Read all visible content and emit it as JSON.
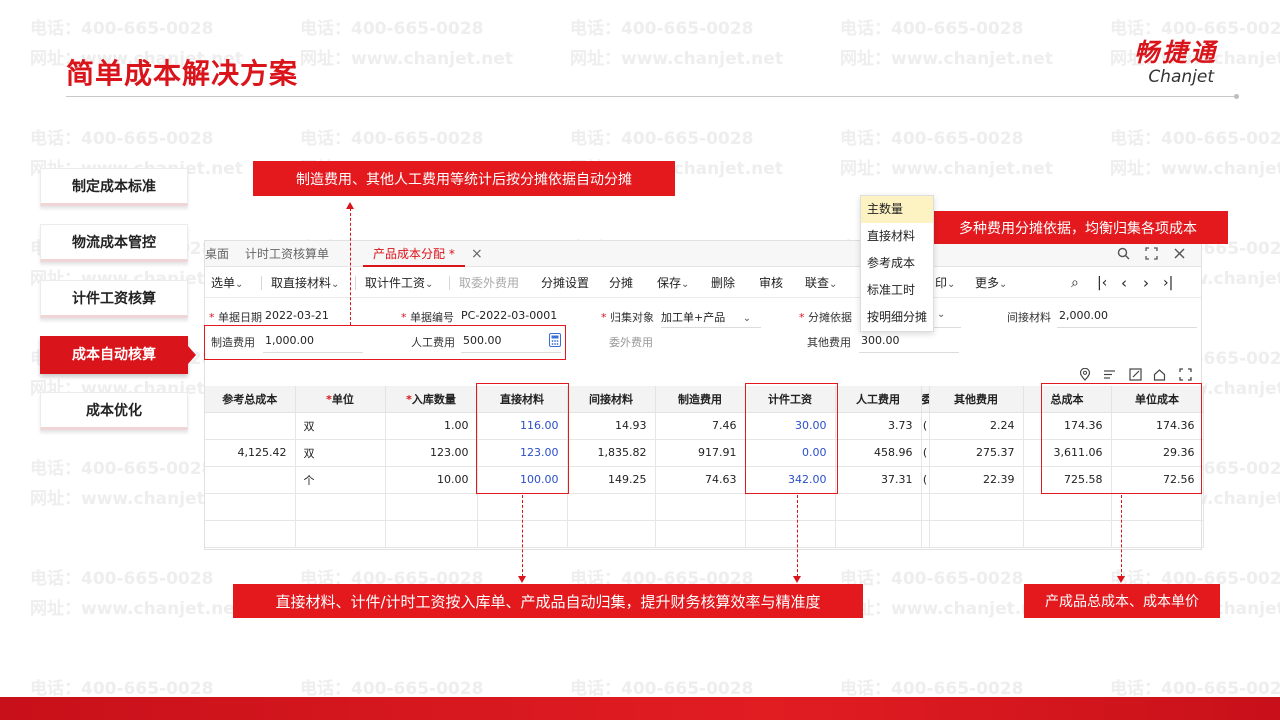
{
  "watermark": {
    "phone": "电话：400-665-0028",
    "site": "网址：www.chanjet.net"
  },
  "page": {
    "title": "简单成本解决方案"
  },
  "logo": {
    "cn": "畅捷通",
    "en": "Chanjet"
  },
  "nav": {
    "items": [
      "制定成本标准",
      "物流成本管控",
      "计件工资核算",
      "成本自动核算",
      "成本优化"
    ],
    "active_index": 3
  },
  "callouts": {
    "top": "制造费用、其他人工费用等统计后按分摊依据自动分摊",
    "right": "多种费用分摊依据，均衡归集各项成本",
    "bottom": "直接材料、计件/计时工资按入库单、产成品自动归集，提升财务核算效率与精准度",
    "bottom_right": "产成品总成本、成本单价"
  },
  "app": {
    "tabs": {
      "partial": "桌面",
      "second": "计时工资核算单",
      "active": "产品成本分配 *",
      "close": "×"
    },
    "toolbar": {
      "select": "选单",
      "take_material": "取直接材料",
      "take_piece": "取计件工资",
      "take_outsource": "取委外费用",
      "alloc_setting": "分摊设置",
      "alloc": "分摊",
      "save": "保存",
      "delete": "删除",
      "audit": "审核",
      "linked": "联查",
      "print_partial": "印",
      "more": "更多"
    },
    "form": {
      "date_label": "单据日期",
      "date_value": "2022-03-21",
      "number_label": "单据编号",
      "number_value": "PC-2022-03-0001",
      "collect_label": "归集对象",
      "collect_value": "加工单+产品",
      "basis_label": "分摊依据",
      "basis_value": "按明细分摊",
      "indirect_label": "间接材料",
      "indirect_value": "2,000.00",
      "mfg_label": "制造费用",
      "mfg_value": "1,000.00",
      "labor_label": "人工费用",
      "labor_value": "500.00",
      "outsource_label": "委外费用",
      "other_label": "其他费用",
      "other_value": "300.00"
    },
    "dropdown": [
      "主数量",
      "直接材料",
      "参考成本",
      "标准工时",
      "按明细分摊"
    ],
    "table": {
      "headers": [
        "参考总成本",
        "单位",
        "入库数量",
        "直接材料",
        "间接材料",
        "制造费用",
        "计件工资",
        "人工费用",
        "委",
        "其他费用",
        "总成本",
        "单位成本"
      ],
      "rows": [
        [
          "",
          "双",
          "1.00",
          "116.00",
          "14.93",
          "7.46",
          "30.00",
          "3.73",
          "(",
          "2.24",
          "174.36",
          "174.36"
        ],
        [
          "4,125.42",
          "双",
          "123.00",
          "123.00",
          "1,835.82",
          "917.91",
          "0.00",
          "458.96",
          "(",
          "275.37",
          "3,611.06",
          "29.36"
        ],
        [
          "",
          "个",
          "10.00",
          "100.00",
          "149.25",
          "74.63",
          "342.00",
          "37.31",
          "(",
          "22.39",
          "725.58",
          "72.56"
        ]
      ]
    }
  },
  "icons": {
    "search": "search-icon",
    "expand": "expand-icon",
    "close": "close-icon"
  },
  "colors": {
    "brand_red": "#d9141b",
    "blue_value": "#2b4fcb",
    "dropdown_selected": "#fdf3c2"
  }
}
